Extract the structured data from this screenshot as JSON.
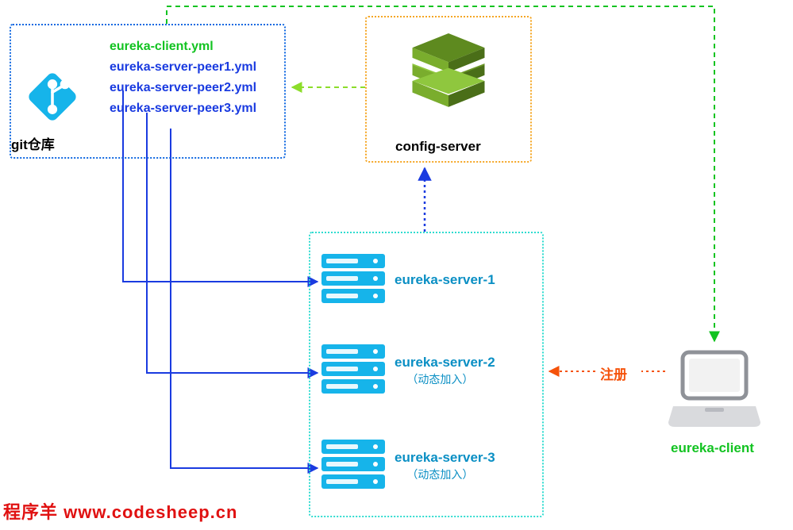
{
  "git": {
    "label": "git仓库",
    "files": [
      {
        "name": "eureka-client.yml",
        "color": "green"
      },
      {
        "name": "eureka-server-peer1.yml",
        "color": "blue"
      },
      {
        "name": "eureka-server-peer2.yml",
        "color": "blue"
      },
      {
        "name": "eureka-server-peer3.yml",
        "color": "blue"
      }
    ]
  },
  "config_server": {
    "label": "config-server"
  },
  "eureka_client": {
    "label": "eureka-client"
  },
  "servers": [
    {
      "label": "eureka-server-1",
      "sub": ""
    },
    {
      "label": "eureka-server-2",
      "sub": "（动态加入）"
    },
    {
      "label": "eureka-server-3",
      "sub": "（动态加入）"
    }
  ],
  "register_label": "注册",
  "watermark": "程序羊 www.codesheep.cn",
  "colors": {
    "blue": "#1169e1",
    "orange": "#f5a623",
    "teal": "#2fdcd0",
    "green": "#12c321",
    "red": "#f5520a"
  }
}
